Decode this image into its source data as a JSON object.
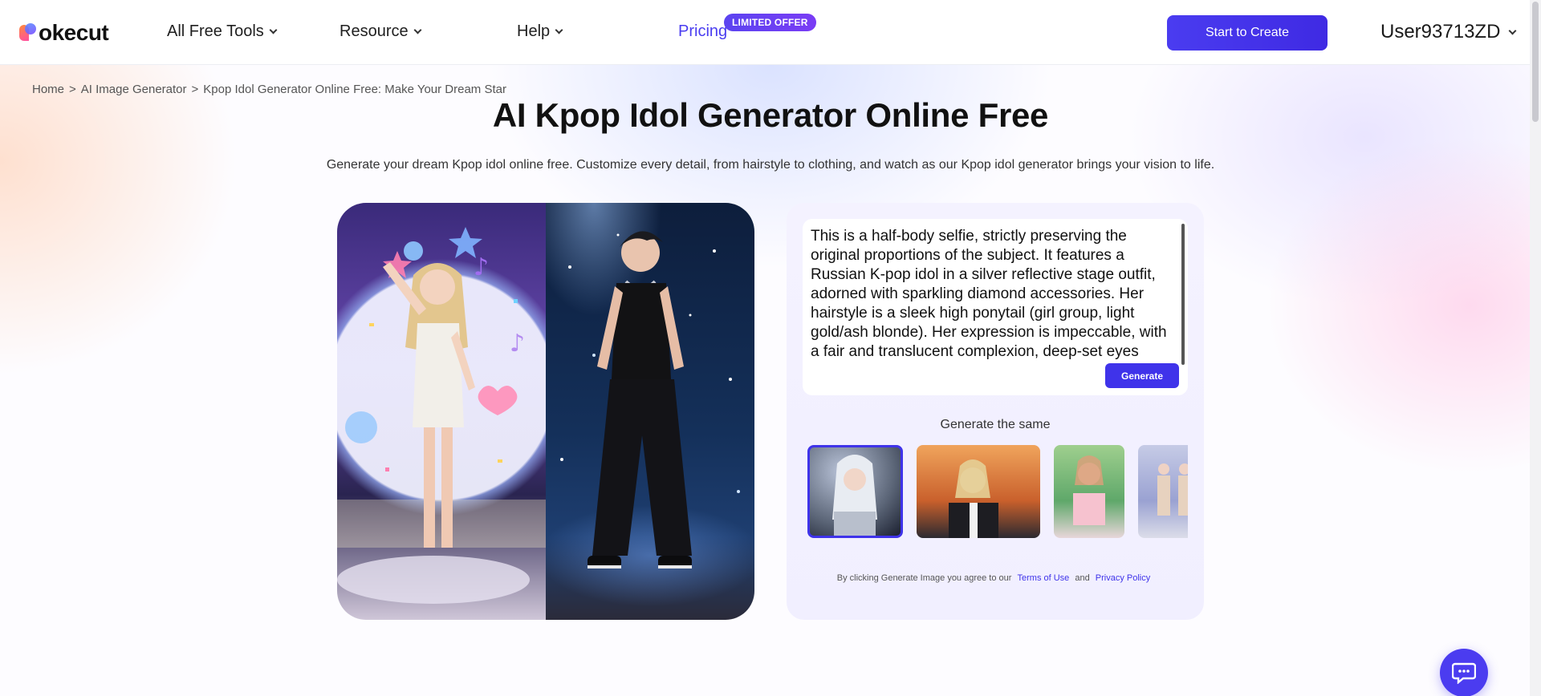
{
  "header": {
    "logo_text": "okecut",
    "nav": [
      {
        "label": "All Free Tools"
      },
      {
        "label": "Resource"
      },
      {
        "label": "Help"
      }
    ],
    "pricing_label": "Pricing",
    "offer_badge": "LIMITED OFFER",
    "start_button": "Start to Create",
    "user_name": "User93713ZD"
  },
  "breadcrumb": {
    "home": "Home",
    "sep": ">",
    "level2": "AI Image Generator",
    "current": "Kpop Idol Generator Online Free: Make Your Dream Star"
  },
  "hero": {
    "title": "AI Kpop Idol Generator Online Free",
    "subtitle": "Generate your dream Kpop idol online free. Customize every detail, from hairstyle to clothing, and watch as our Kpop idol generator brings your vision to life."
  },
  "generator": {
    "prompt_text": "This is a half-body selfie, strictly preserving the original proportions of the subject. It features a Russian K-pop idol in a silver reflective stage outfit, adorned with sparkling diamond accessories. Her hairstyle is a sleek high ponytail (girl group, light gold/ash blonde). Her expression is impeccable, with a fair and translucent complexion, deep-set eyes",
    "generate_button": "Generate",
    "same_label": "Generate the same",
    "legal_prefix": "By clicking Generate Image you agree to our",
    "terms_link": "Terms of Use",
    "and_text": "and",
    "privacy_link": "Privacy Policy"
  },
  "colors": {
    "accent": "#3f33ea",
    "pricing": "#4a3df0"
  },
  "icons": {
    "nav_chevron": "chevron-down-icon",
    "chat": "chat-bubble-icon"
  }
}
